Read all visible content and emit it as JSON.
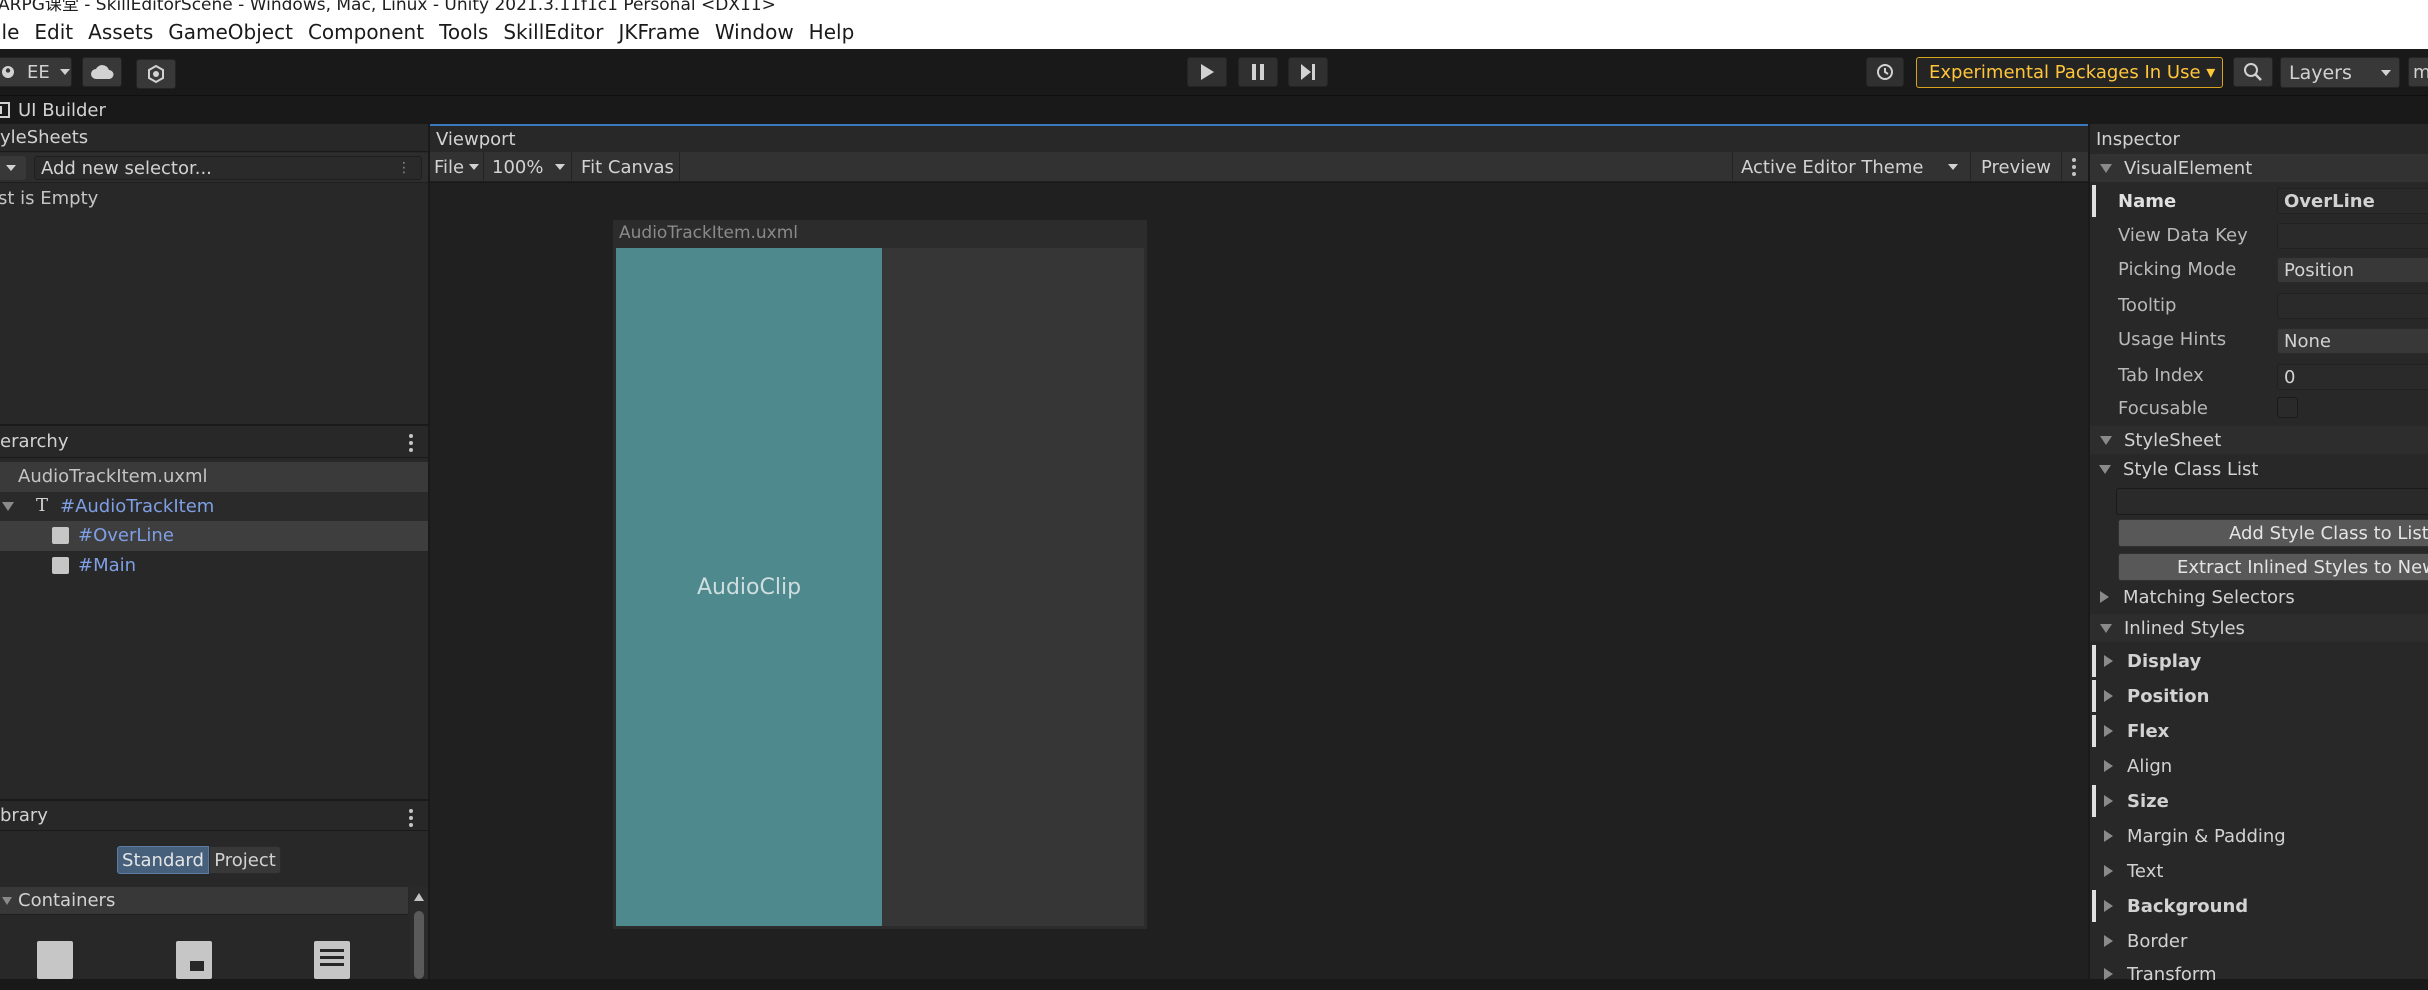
{
  "window": {
    "title": "ARPG课堂 - SkillEditorScene - Windows, Mac, Linux - Unity 2021.3.11f1c1 Personal <DX11>"
  },
  "menubar": [
    "ile",
    "Edit",
    "Assets",
    "GameObject",
    "Component",
    "Tools",
    "SkillEditor",
    "JKFrame",
    "Window",
    "Help"
  ],
  "toolbar": {
    "account_label": "EE",
    "experimental_label": "Experimental Packages In Use ▾",
    "layers_label": "Layers",
    "layout_label": "m"
  },
  "builder": {
    "tab_title": "UI Builder"
  },
  "stylesheets": {
    "title": "yleSheets",
    "selector_placeholder": "Add new selector...",
    "selector_dots": "⋮",
    "empty_text": "st is Empty"
  },
  "hierarchy": {
    "title": "erarchy",
    "root": "AudioTrackItem.uxml",
    "items": [
      {
        "label": "#AudioTrackItem",
        "level": 1
      },
      {
        "label": "#OverLine",
        "level": 2,
        "selected": true
      },
      {
        "label": "#Main",
        "level": 2
      }
    ]
  },
  "library": {
    "title": "brary",
    "tabs": [
      "Standard",
      "Project"
    ],
    "active_tab": "Standard",
    "section": "Containers"
  },
  "viewport": {
    "title": "Viewport",
    "file_menu": "File",
    "zoom": "100%",
    "fit_canvas": "Fit Canvas",
    "theme": "Active Editor Theme",
    "preview": "Preview",
    "canvas_title": "AudioTrackItem.uxml",
    "clip_label": "AudioClip",
    "clip_color": "#4e898e",
    "main_color": "#363636"
  },
  "inspector": {
    "title": "Inspector",
    "visual_element_header": "VisualElement",
    "fields": [
      {
        "label": "Name",
        "value": "OverLine"
      },
      {
        "label": "View Data Key",
        "value": ""
      },
      {
        "label": "Picking Mode",
        "value": "Position"
      },
      {
        "label": "Tooltip",
        "value": ""
      },
      {
        "label": "Usage Hints",
        "value": "None"
      },
      {
        "label": "Tab Index",
        "value": "0"
      },
      {
        "label": "Focusable",
        "value": ""
      }
    ],
    "stylesheet_header": "StyleSheet",
    "style_class_list": "Style Class List",
    "add_style_class": "Add Style Class to List",
    "extract_inlined": "Extract Inlined Styles to New C",
    "matching_selectors": "Matching Selectors",
    "inlined_styles": "Inlined Styles",
    "style_groups": [
      "Display",
      "Position",
      "Flex",
      "Align",
      "Size",
      "Margin & Padding",
      "Text",
      "Background",
      "Border",
      "Transform"
    ]
  },
  "colors": {
    "accent_blue": "#3a79bb",
    "warning_yellow": "#ffc63a",
    "hierarchy_blue": "#7f9fe5"
  }
}
